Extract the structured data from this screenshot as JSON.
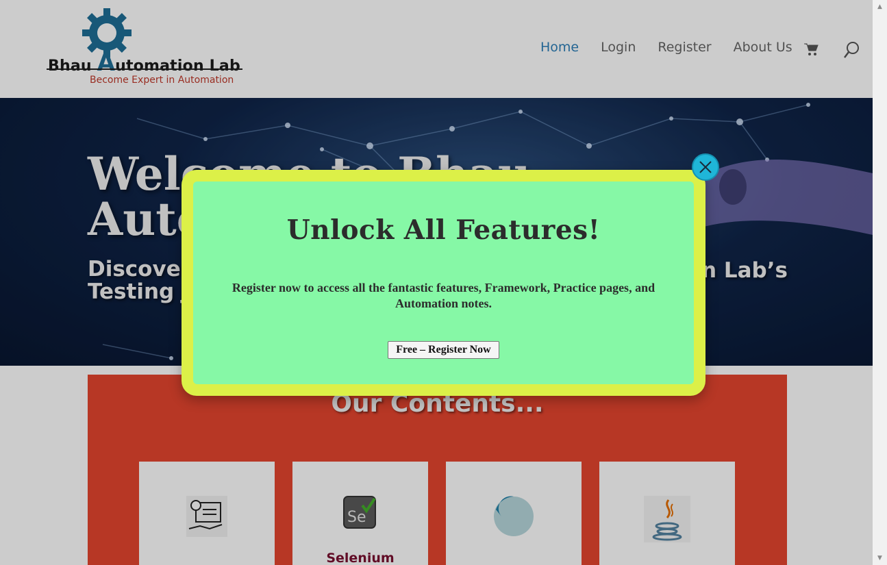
{
  "header": {
    "logo": {
      "name_part1": "Bhau ",
      "name_letter": "A",
      "name_part2": "utomation Lab",
      "tagline": "Become Expert in Automation"
    },
    "nav": {
      "items": [
        {
          "label": "Home",
          "active": true
        },
        {
          "label": "Login",
          "active": false
        },
        {
          "label": "Register",
          "active": false
        },
        {
          "label": "About Us",
          "active": false
        }
      ],
      "cart_icon": "cart-icon",
      "search_icon": "search-icon"
    }
  },
  "hero": {
    "title_line1": "Welcome to Bhau",
    "title_line2": "Auto",
    "subtitle_left_line1": "Discover",
    "subtitle_left_line2": "Testing J",
    "subtitle_right": "n Lab’s"
  },
  "contents": {
    "title": "Our Contents...",
    "cards": [
      {
        "icon": "checklist-gear-icon",
        "label": ""
      },
      {
        "icon": "selenium-icon",
        "label": "Selenium"
      },
      {
        "icon": "cypress-icon",
        "label": ""
      },
      {
        "icon": "java-icon",
        "label": ""
      }
    ]
  },
  "modal": {
    "title": "Unlock All Features!",
    "text": "Register now to access all the fantastic features, Framework, Practice pages, and Automation notes.",
    "button_label": "Free – Register Now",
    "close_icon": "close-icon"
  },
  "colors": {
    "accent_nav": "#2c7fb8",
    "modal_border": "#dcf048",
    "modal_bg": "#86f8a6",
    "close_bg": "#1fb6d8",
    "contents_bg": "#e5452f"
  }
}
